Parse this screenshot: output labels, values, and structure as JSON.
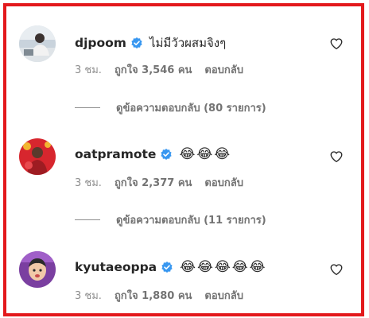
{
  "comments": [
    {
      "username": "djpoom",
      "text": "ไม่มีวัวผสมจิงๆ",
      "emojis": [],
      "time": "3 ชม.",
      "likes": "ถูกใจ 3,546 คน",
      "reply": "ตอบกลับ",
      "view_replies": "ดูข้อความตอบกลับ (80 รายการ)",
      "avatar_icon": "avatar-photo-man-sitting"
    },
    {
      "username": "oatpramote",
      "text": "",
      "emojis": [
        "😂",
        "😂",
        "😂"
      ],
      "time": "3 ชม.",
      "likes": "ถูกใจ 2,377 คน",
      "reply": "ตอบกลับ",
      "view_replies": "ดูข้อความตอบกลับ (11 รายการ)",
      "avatar_icon": "avatar-photo-red-background"
    },
    {
      "username": "kyutaeoppa",
      "text": "",
      "emojis": [
        "😂",
        "😂",
        "😂",
        "😂",
        "😂"
      ],
      "time": "3 ชม.",
      "likes": "ถูกใจ 1,880 คน",
      "reply": "ตอบกลับ",
      "avatar_icon": "avatar-photo-purple-background"
    }
  ],
  "colors": {
    "frame_border": "#e3191c",
    "verified_badge": "#3897f0",
    "muted_text": "#8e8e8e"
  }
}
